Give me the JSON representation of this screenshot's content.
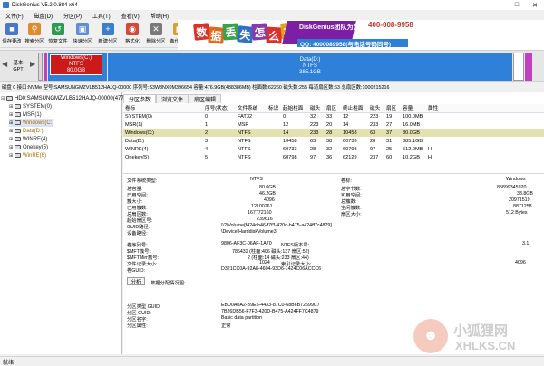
{
  "window": {
    "title": "DiskGenius V5.2.0.884 x64"
  },
  "menu": [
    "文件(F)",
    "磁盘(D)",
    "分区(P)",
    "工具(T)",
    "查看(V)",
    "帮助(H)"
  ],
  "toolbar": [
    {
      "label": "保存更改",
      "icon": "save-icon",
      "color": "#4a78c8"
    },
    {
      "label": "搜索分区",
      "icon": "search-icon",
      "color": "#e08a2b"
    },
    {
      "label": "恢复文件",
      "icon": "recover-icon",
      "color": "#2f9a52"
    },
    {
      "label": "快速分区",
      "icon": "quick-partition-icon",
      "color": "#5c8fd6"
    },
    {
      "label": "新建分区",
      "icon": "new-partition-icon",
      "color": "#3a7fc8"
    },
    {
      "label": "格式化",
      "icon": "format-icon",
      "color": "#d04a3a"
    },
    {
      "label": "删除分区",
      "icon": "delete-icon",
      "color": "#7a7a7a"
    },
    {
      "label": "备份分区",
      "icon": "backup-icon",
      "color": "#d6a12b"
    }
  ],
  "banner": {
    "tiles": [
      {
        "char": "数",
        "color": "#d8322a"
      },
      {
        "char": "据",
        "color": "#e06a1a"
      },
      {
        "char": "丢",
        "color": "#3aa04a"
      },
      {
        "char": "失",
        "color": "#2f6fc8"
      },
      {
        "char": "怎",
        "color": "#8a3ab0"
      },
      {
        "char": "么",
        "color": "#d8322a"
      },
      {
        "char": "办",
        "color": "#e0a21a"
      }
    ],
    "team": "DiskGenius团队为您服务",
    "phone": "400-008-9958",
    "qq": "QQ: 4000089958(与电话号码同号)"
  },
  "disk_bar": {
    "label_lines": [
      "基本",
      "GPT"
    ],
    "partitions": [
      {
        "name": "",
        "fs": "",
        "size": "",
        "color": "#d8d8d8"
      },
      {
        "name": "",
        "fs": "",
        "size": "",
        "color": "#c040c0"
      },
      {
        "name": "Windows(C:)",
        "fs": "NTFS",
        "size": "80.0GB",
        "color": "#2f80d8"
      },
      {
        "name": "Data(D:)",
        "fs": "NTFS",
        "size": "385.1GB",
        "color": "#2f80d8"
      },
      {
        "name": "",
        "fs": "",
        "size": "",
        "color": "#ffffff"
      },
      {
        "name": "",
        "fs": "",
        "size": "",
        "color": "#c040c0"
      }
    ]
  },
  "disk_info": "磁盘 0 接口:NVMe 型号:SAMSUNGMZVLB512HAJQ-00000 序列号:S3W8NX0M396654 容量:476.9GB(488386MB) 柱面数:62260 磁头数:255 每道扇区数:63 总扇区数:1000215216",
  "tree": {
    "root": "HD0:SAMSUNGMZVLB512HAJQ-00000(477",
    "items": [
      {
        "label": "SYSTEM(0)",
        "color": "#222"
      },
      {
        "label": "MSR(1)",
        "color": "#222"
      },
      {
        "label": "Windows(C:)",
        "color": "#b06a00"
      },
      {
        "label": "Data(D:)",
        "color": "#b06a00"
      },
      {
        "label": "WINRE(4)",
        "color": "#222"
      },
      {
        "label": "Onekey(5)",
        "color": "#222"
      },
      {
        "label": "WinRE(6)",
        "color": "#b06a00"
      }
    ]
  },
  "tabs": [
    "分区参数",
    "浏览文件",
    "扇区编辑"
  ],
  "partition_table": {
    "headers": [
      "卷标",
      "序号(状态)",
      "文件系统",
      "标识",
      "起始柱面",
      "磁头",
      "扇区",
      "终止柱面",
      "磁头",
      "扇区",
      "容量",
      "属性"
    ],
    "rows": [
      [
        "SYSTEM(0)",
        "0",
        "FAT32",
        "",
        "0",
        "32",
        "33",
        "12",
        "223",
        "19",
        "100.0MB",
        ""
      ],
      [
        "MSR(1)",
        "1",
        "MSR",
        "",
        "12",
        "223",
        "20",
        "14",
        "233",
        "27",
        "16.0MB",
        ""
      ],
      [
        "Windows(C:)",
        "2",
        "NTFS",
        "",
        "14",
        "233",
        "28",
        "10458",
        "63",
        "37",
        "80.0GB",
        ""
      ],
      [
        "Data(D:)",
        "3",
        "NTFS",
        "",
        "10458",
        "63",
        "38",
        "60733",
        "28",
        "31",
        "385.1GB",
        ""
      ],
      [
        "WINRE(4)",
        "4",
        "NTFS",
        "",
        "60733",
        "28",
        "32",
        "60798",
        "97",
        "25",
        "512.0MB",
        "H"
      ],
      [
        "Onekey(5)",
        "5",
        "NTFS",
        "",
        "60798",
        "97",
        "36",
        "62129",
        "237",
        "60",
        "10.2GB",
        "H"
      ]
    ]
  },
  "details": {
    "fs_type_label": "文件系统类型:",
    "fs_type": "NTFS",
    "vol_label_label": "卷标:",
    "vol_label": "Windows",
    "rows": [
      {
        "k1": "总容量:",
        "v1": "80.0GB",
        "k2": "总字节数:",
        "v2": "85899345920"
      },
      {
        "k1": "已用空间:",
        "v1": "46.2GB",
        "k2": "可用空间:",
        "v2": "33.8GB"
      },
      {
        "k1": "簇大小:",
        "v1": "4096",
        "k2": "总簇数:",
        "v2": "20971519"
      },
      {
        "k1": "已用簇数:",
        "v1": "12100261",
        "k2": "空闲簇数:",
        "v2": "8871258"
      },
      {
        "k1": "总扇区数:",
        "v1": "167772160",
        "k2": "扇区大小:",
        "v2": "512 Bytes"
      }
    ],
    "start_sector_label": "起始扇区号:",
    "start_sector": "239616",
    "guid_path_label": "GUID路径:",
    "guid_path": "\\\\?\\Volume{f424db46-f7f3-420d-b475-a424ff7c4879}",
    "device_path_label": "设备路径:",
    "device_path": "\\Device\\HarddiskVolume3",
    "ntfs": [
      {
        "k1": "卷序列号:",
        "v1": "9806-AF3C-06AF-1A70",
        "k2": "NTFS版本号:",
        "v2": "3.1"
      },
      {
        "k1": "$MFT簇号:",
        "v1": "786432 (柱面:406 磁头:137 扇区:52)",
        "k2": "",
        "v2": ""
      },
      {
        "k1": "$MFTMirr簇号:",
        "v1": "2 (柱面:14 磁头:233 扇区:44)",
        "k2": "",
        "v2": ""
      },
      {
        "k1": "文件记录大小:",
        "v1": "1024",
        "k2": "索引记录大小:",
        "v2": "4096"
      },
      {
        "k1": "卷GUID:",
        "v1": "D321CC0A-92A8-4604-93D6-1424C06ACCC6",
        "k2": "",
        "v2": ""
      }
    ],
    "analyze_button": "分析",
    "alloc_map_label": "数据分配情况图:",
    "type_guid_label": "分区类型 GUID:",
    "type_guid": "EBD0A0A2-B9E5-4433-87C0-68B6B72699C7",
    "part_guid_label": "分区 GUID:",
    "part_guid": "7B26DB56-F7F3-420D-B475-A424FF7C4879",
    "part_name_label": "分区名字:",
    "part_name": "Basic data partition",
    "part_attr_label": "分区属性:",
    "part_attr": "正常"
  },
  "status": "就绪",
  "watermark": {
    "cn": "小狐狸网",
    "en": "XHLKS.CN"
  }
}
